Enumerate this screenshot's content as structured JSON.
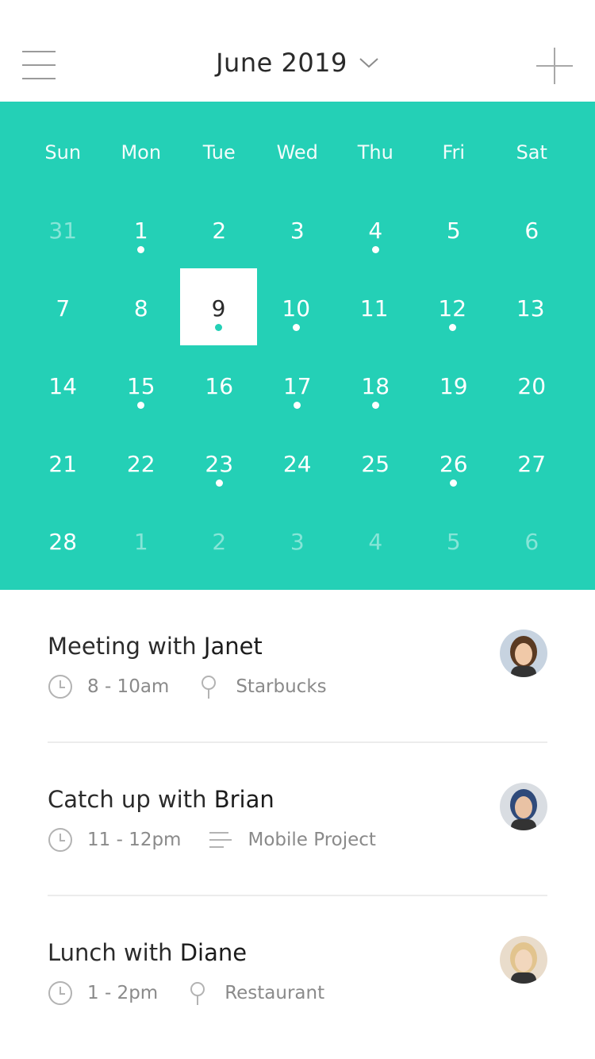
{
  "header": {
    "month_title": "June 2019"
  },
  "colors": {
    "accent": "#24d0b6"
  },
  "weekdays": [
    "Sun",
    "Mon",
    "Tue",
    "Wed",
    "Thu",
    "Fri",
    "Sat"
  ],
  "calendar": {
    "weeks": [
      [
        {
          "n": "31",
          "muted": true,
          "dot": false
        },
        {
          "n": "1",
          "muted": false,
          "dot": true
        },
        {
          "n": "2",
          "muted": false,
          "dot": false
        },
        {
          "n": "3",
          "muted": false,
          "dot": false
        },
        {
          "n": "4",
          "muted": false,
          "dot": true
        },
        {
          "n": "5",
          "muted": false,
          "dot": false
        },
        {
          "n": "6",
          "muted": false,
          "dot": false
        }
      ],
      [
        {
          "n": "7",
          "muted": false,
          "dot": false
        },
        {
          "n": "8",
          "muted": false,
          "dot": false
        },
        {
          "n": "9",
          "muted": false,
          "dot": true,
          "selected": true
        },
        {
          "n": "10",
          "muted": false,
          "dot": true
        },
        {
          "n": "11",
          "muted": false,
          "dot": false
        },
        {
          "n": "12",
          "muted": false,
          "dot": true
        },
        {
          "n": "13",
          "muted": false,
          "dot": false
        }
      ],
      [
        {
          "n": "14",
          "muted": false,
          "dot": false
        },
        {
          "n": "15",
          "muted": false,
          "dot": true
        },
        {
          "n": "16",
          "muted": false,
          "dot": false
        },
        {
          "n": "17",
          "muted": false,
          "dot": true
        },
        {
          "n": "18",
          "muted": false,
          "dot": true
        },
        {
          "n": "19",
          "muted": false,
          "dot": false
        },
        {
          "n": "20",
          "muted": false,
          "dot": false
        }
      ],
      [
        {
          "n": "21",
          "muted": false,
          "dot": false
        },
        {
          "n": "22",
          "muted": false,
          "dot": false
        },
        {
          "n": "23",
          "muted": false,
          "dot": true
        },
        {
          "n": "24",
          "muted": false,
          "dot": false
        },
        {
          "n": "25",
          "muted": false,
          "dot": false
        },
        {
          "n": "26",
          "muted": false,
          "dot": true
        },
        {
          "n": "27",
          "muted": false,
          "dot": false
        }
      ],
      [
        {
          "n": "28",
          "muted": false,
          "dot": false
        },
        {
          "n": "1",
          "muted": true,
          "dot": false
        },
        {
          "n": "2",
          "muted": true,
          "dot": false
        },
        {
          "n": "3",
          "muted": true,
          "dot": false
        },
        {
          "n": "4",
          "muted": true,
          "dot": false
        },
        {
          "n": "5",
          "muted": true,
          "dot": false
        },
        {
          "n": "6",
          "muted": true,
          "dot": false
        }
      ]
    ]
  },
  "events": [
    {
      "title_prefix": "Meeting with",
      "person": "Janet",
      "time": "8 - 10am",
      "detail_icon": "location-pin-icon",
      "detail": "Starbucks",
      "avatar": {
        "skin": "#f0c9a8",
        "hair": "#5a3a22",
        "bg": "#c7d3e0"
      }
    },
    {
      "title_prefix": "Catch up with",
      "person": "Brian",
      "time": "11 - 12pm",
      "detail_icon": "notes-icon",
      "detail": "Mobile Project",
      "avatar": {
        "skin": "#e9c2a4",
        "hair": "#2f4a7a",
        "bg": "#d9dde2"
      }
    },
    {
      "title_prefix": "Lunch with",
      "person": "Diane",
      "time": "1 - 2pm",
      "detail_icon": "location-pin-icon",
      "detail": "Restaurant",
      "avatar": {
        "skin": "#f2d7bd",
        "hair": "#e2c48e",
        "bg": "#e9dccb"
      }
    }
  ]
}
